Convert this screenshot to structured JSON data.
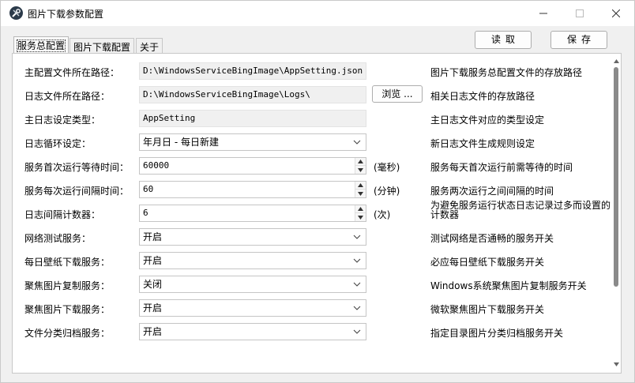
{
  "window": {
    "title": "图片下载参数配置",
    "controls": {
      "minimize": "minimize-icon",
      "maximize": "maximize-icon",
      "close": "close-icon"
    }
  },
  "tabs": [
    "服务总配置",
    "图片下载配置",
    "关于"
  ],
  "buttons": {
    "read": "读取",
    "save": "保存",
    "browse": "浏览 ..."
  },
  "rows": [
    {
      "label": "主配置文件所在路径：",
      "value": "D:\\WindowsServiceBingImage\\AppSetting.json",
      "desc": "图片下载服务总配置文件的存放路径"
    },
    {
      "label": "日志文件所在路径：",
      "value": "D:\\WindowsServiceBingImage\\Logs\\",
      "desc": "相关日志文件的存放路径"
    },
    {
      "label": "主日志设定类型：",
      "value": "AppSetting",
      "desc": "主日志文件对应的类型设定"
    },
    {
      "label": "日志循环设定：",
      "value": "年月日 - 每日新建",
      "desc": "新日志文件生成规则设定"
    },
    {
      "label": "服务首次运行等待时间：",
      "value": "60000",
      "unit": "(毫秒)",
      "desc": "服务每天首次运行前需等待的时间"
    },
    {
      "label": "服务每次运行间隔时间：",
      "value": "60",
      "unit": "(分钟)",
      "desc": "服务两次运行之间间隔的时间"
    },
    {
      "label": "日志间隔计数器：",
      "value": "6",
      "unit": "(次)",
      "desc": "为避免服务运行状态日志记录过多而设置的计数器"
    },
    {
      "label": "网络测试服务：",
      "value": "开启",
      "desc": "测试网络是否通畅的服务开关"
    },
    {
      "label": "每日壁纸下载服务：",
      "value": "开启",
      "desc": "必应每日壁纸下载服务开关"
    },
    {
      "label": "聚焦图片复制服务：",
      "value": "关闭",
      "desc": "Windows系统聚焦图片复制服务开关"
    },
    {
      "label": "聚焦图片下载服务：",
      "value": "开启",
      "desc": "微软聚焦图片下载服务开关"
    },
    {
      "label": "文件分类归档服务：",
      "value": "开启",
      "desc": "指定目录图片分类归档服务开关"
    }
  ]
}
